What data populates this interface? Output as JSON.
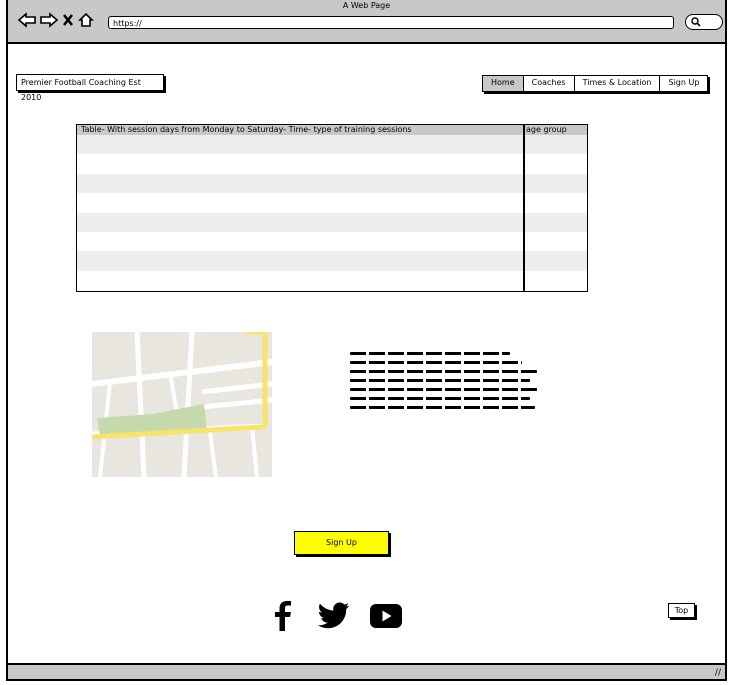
{
  "browser": {
    "title": "A Web Page",
    "url": "https://"
  },
  "header": {
    "logo_text": "Premier Football Coaching Est 2010",
    "nav": [
      {
        "label": "Home",
        "active": true
      },
      {
        "label": "Coaches",
        "active": false
      },
      {
        "label": "Times & Location",
        "active": false
      },
      {
        "label": "Sign Up",
        "active": false
      }
    ]
  },
  "table": {
    "col1_header": "Table- With session days from Monday to Saturday- Time- type of training sessions",
    "col2_header": "age group",
    "row_count": 8
  },
  "map": {
    "icon": "map-image"
  },
  "text_block": {
    "lines": 7
  },
  "buttons": {
    "signup_label": "Sign Up",
    "top_label": "Top"
  },
  "social": [
    "facebook-icon",
    "twitter-icon",
    "youtube-icon"
  ],
  "colors": {
    "chrome": "#c8c8c8",
    "accent": "#ffff00",
    "map_park": "#c5d9ad",
    "map_road_major": "#f7e46b"
  }
}
